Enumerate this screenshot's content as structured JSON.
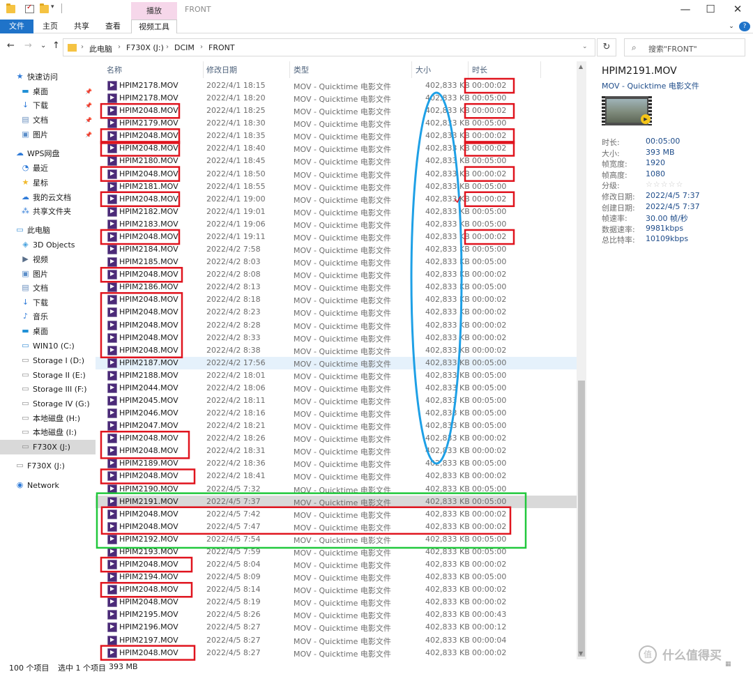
{
  "titlebar": {
    "context_tab": "播放",
    "window_title": "FRONT",
    "minimize": "—",
    "maximize": "☐",
    "close": "✕"
  },
  "ribbon": {
    "tabs": [
      "文件",
      "主页",
      "共享",
      "查看",
      "视频工具"
    ],
    "help": "?"
  },
  "address": {
    "back": "←",
    "forward": "→",
    "recent": "⌄",
    "up": "↑",
    "crumbs": [
      "此电脑",
      "F730X (J:)",
      "DCIM",
      "FRONT"
    ],
    "refresh": "↻",
    "search_placeholder": "搜索\"FRONT\""
  },
  "sidebar": {
    "items": [
      {
        "label": "快速访问",
        "icon": "star-icon",
        "color": "#2f7bd8"
      },
      {
        "label": "桌面",
        "icon": "desktop-icon",
        "color": "#1f8fd6",
        "pinned": true
      },
      {
        "label": "下载",
        "icon": "download-icon",
        "color": "#2f7bd8",
        "pinned": true
      },
      {
        "label": "文档",
        "icon": "document-icon",
        "color": "#6a8fbf",
        "pinned": true
      },
      {
        "label": "图片",
        "icon": "picture-icon",
        "color": "#5b8ec9",
        "pinned": true
      },
      {
        "label": "WPS网盘",
        "icon": "cloud-icon",
        "color": "#2f7bd8"
      },
      {
        "label": "最近",
        "icon": "clock-icon",
        "color": "#2f7bd8"
      },
      {
        "label": "星标",
        "icon": "star-icon",
        "color": "#f1b92b"
      },
      {
        "label": "我的云文档",
        "icon": "cloud-doc-icon",
        "color": "#2f7bd8"
      },
      {
        "label": "共享文件夹",
        "icon": "share-icon",
        "color": "#2f7bd8"
      },
      {
        "label": "此电脑",
        "icon": "computer-icon",
        "color": "#3c8fd6"
      },
      {
        "label": "3D Objects",
        "icon": "cube-icon",
        "color": "#4aa3df"
      },
      {
        "label": "视频",
        "icon": "video-icon",
        "color": "#5a6f8a"
      },
      {
        "label": "图片",
        "icon": "picture-icon",
        "color": "#5b8ec9"
      },
      {
        "label": "文档",
        "icon": "document-icon",
        "color": "#6a8fbf"
      },
      {
        "label": "下载",
        "icon": "download-icon",
        "color": "#2f7bd8"
      },
      {
        "label": "音乐",
        "icon": "music-icon",
        "color": "#2f7bd8"
      },
      {
        "label": "桌面",
        "icon": "desktop-icon",
        "color": "#1f8fd6"
      },
      {
        "label": "WIN10 (C:)",
        "icon": "windows-drive-icon",
        "color": "#3c8fd6"
      },
      {
        "label": "Storage I (D:)",
        "icon": "drive-icon",
        "color": "#8c8c8c"
      },
      {
        "label": "Storage II (E:)",
        "icon": "drive-icon",
        "color": "#8c8c8c"
      },
      {
        "label": "Storage III (F:)",
        "icon": "drive-icon",
        "color": "#8c8c8c"
      },
      {
        "label": "Storage IV (G:)",
        "icon": "drive-icon",
        "color": "#8c8c8c"
      },
      {
        "label": "本地磁盘 (H:)",
        "icon": "drive-icon",
        "color": "#8c8c8c"
      },
      {
        "label": "本地磁盘 (I:)",
        "icon": "drive-icon",
        "color": "#8c8c8c"
      },
      {
        "label": "F730X (J:)",
        "icon": "usb-drive-icon",
        "color": "#8c8c8c",
        "selected": true
      },
      {
        "label": "F730X (J:)",
        "icon": "usb-drive-icon",
        "color": "#8c8c8c"
      },
      {
        "label": "Network",
        "icon": "network-icon",
        "color": "#2f7bd8"
      }
    ]
  },
  "columns": [
    "名称",
    "修改日期",
    "类型",
    "大小",
    "时长"
  ],
  "files": [
    {
      "name": "HPIM2178.MOV",
      "date": "2022/4/1 18:15",
      "type": "MOV - Quicktime 电影文件",
      "size": "402,833 KB",
      "duration": "00:00:02"
    },
    {
      "name": "HPIM2178.MOV",
      "date": "2022/4/1 18:20",
      "type": "MOV - Quicktime 电影文件",
      "size": "402,833 KB",
      "duration": "00:05:00"
    },
    {
      "name": "HPIM2048.MOV",
      "date": "2022/4/1 18:25",
      "type": "MOV - Quicktime 电影文件",
      "size": "402,833 KB",
      "duration": "00:00:02"
    },
    {
      "name": "HPIM2179.MOV",
      "date": "2022/4/1 18:30",
      "type": "MOV - Quicktime 电影文件",
      "size": "402,833 KB",
      "duration": "00:05:00"
    },
    {
      "name": "HPIM2048.MOV",
      "date": "2022/4/1 18:35",
      "type": "MOV - Quicktime 电影文件",
      "size": "402,833 KB",
      "duration": "00:00:02"
    },
    {
      "name": "HPIM2048.MOV",
      "date": "2022/4/1 18:40",
      "type": "MOV - Quicktime 电影文件",
      "size": "402,833 KB",
      "duration": "00:00:02"
    },
    {
      "name": "HPIM2180.MOV",
      "date": "2022/4/1 18:45",
      "type": "MOV - Quicktime 电影文件",
      "size": "402,833 KB",
      "duration": "00:05:00"
    },
    {
      "name": "HPIM2048.MOV",
      "date": "2022/4/1 18:50",
      "type": "MOV - Quicktime 电影文件",
      "size": "402,833 KB",
      "duration": "00:00:02"
    },
    {
      "name": "HPIM2181.MOV",
      "date": "2022/4/1 18:55",
      "type": "MOV - Quicktime 电影文件",
      "size": "402,833 KB",
      "duration": "00:05:00"
    },
    {
      "name": "HPIM2048.MOV",
      "date": "2022/4/1 19:00",
      "type": "MOV - Quicktime 电影文件",
      "size": "402,833 KB",
      "duration": "00:00:02"
    },
    {
      "name": "HPIM2182.MOV",
      "date": "2022/4/1 19:01",
      "type": "MOV - Quicktime 电影文件",
      "size": "402,833 KB",
      "duration": "00:05:00"
    },
    {
      "name": "HPIM2183.MOV",
      "date": "2022/4/1 19:06",
      "type": "MOV - Quicktime 电影文件",
      "size": "402,833 KB",
      "duration": "00:05:00"
    },
    {
      "name": "HPIM2048.MOV",
      "date": "2022/4/1 19:11",
      "type": "MOV - Quicktime 电影文件",
      "size": "402,833 KB",
      "duration": "00:00:02"
    },
    {
      "name": "HPIM2184.MOV",
      "date": "2022/4/2 7:58",
      "type": "MOV - Quicktime 电影文件",
      "size": "402,833 KB",
      "duration": "00:05:00"
    },
    {
      "name": "HPIM2185.MOV",
      "date": "2022/4/2 8:03",
      "type": "MOV - Quicktime 电影文件",
      "size": "402,833 KB",
      "duration": "00:05:00"
    },
    {
      "name": "HPIM2048.MOV",
      "date": "2022/4/2 8:08",
      "type": "MOV - Quicktime 电影文件",
      "size": "402,833 KB",
      "duration": "00:00:02"
    },
    {
      "name": "HPIM2186.MOV",
      "date": "2022/4/2 8:13",
      "type": "MOV - Quicktime 电影文件",
      "size": "402,833 KB",
      "duration": "00:05:00"
    },
    {
      "name": "HPIM2048.MOV",
      "date": "2022/4/2 8:18",
      "type": "MOV - Quicktime 电影文件",
      "size": "402,833 KB",
      "duration": "00:00:02"
    },
    {
      "name": "HPIM2048.MOV",
      "date": "2022/4/2 8:23",
      "type": "MOV - Quicktime 电影文件",
      "size": "402,833 KB",
      "duration": "00:00:02"
    },
    {
      "name": "HPIM2048.MOV",
      "date": "2022/4/2 8:28",
      "type": "MOV - Quicktime 电影文件",
      "size": "402,833 KB",
      "duration": "00:00:02"
    },
    {
      "name": "HPIM2048.MOV",
      "date": "2022/4/2 8:33",
      "type": "MOV - Quicktime 电影文件",
      "size": "402,833 KB",
      "duration": "00:00:02"
    },
    {
      "name": "HPIM2048.MOV",
      "date": "2022/4/2 8:38",
      "type": "MOV - Quicktime 电影文件",
      "size": "402,833 KB",
      "duration": "00:00:02"
    },
    {
      "name": "HPIM2187.MOV",
      "date": "2022/4/2 17:56",
      "type": "MOV - Quicktime 电影文件",
      "size": "402,833 KB",
      "duration": "00:05:00"
    },
    {
      "name": "HPIM2188.MOV",
      "date": "2022/4/2 18:01",
      "type": "MOV - Quicktime 电影文件",
      "size": "402,833 KB",
      "duration": "00:05:00"
    },
    {
      "name": "HPIM2044.MOV",
      "date": "2022/4/2 18:06",
      "type": "MOV - Quicktime 电影文件",
      "size": "402,833 KB",
      "duration": "00:05:00"
    },
    {
      "name": "HPIM2045.MOV",
      "date": "2022/4/2 18:11",
      "type": "MOV - Quicktime 电影文件",
      "size": "402,833 KB",
      "duration": "00:05:00"
    },
    {
      "name": "HPIM2046.MOV",
      "date": "2022/4/2 18:16",
      "type": "MOV - Quicktime 电影文件",
      "size": "402,833 KB",
      "duration": "00:05:00"
    },
    {
      "name": "HPIM2047.MOV",
      "date": "2022/4/2 18:21",
      "type": "MOV - Quicktime 电影文件",
      "size": "402,833 KB",
      "duration": "00:05:00"
    },
    {
      "name": "HPIM2048.MOV",
      "date": "2022/4/2 18:26",
      "type": "MOV - Quicktime 电影文件",
      "size": "402,833 KB",
      "duration": "00:00:02"
    },
    {
      "name": "HPIM2048.MOV",
      "date": "2022/4/2 18:31",
      "type": "MOV - Quicktime 电影文件",
      "size": "402,833 KB",
      "duration": "00:00:02"
    },
    {
      "name": "HPIM2189.MOV",
      "date": "2022/4/2 18:36",
      "type": "MOV - Quicktime 电影文件",
      "size": "402,833 KB",
      "duration": "00:05:00"
    },
    {
      "name": "HPIM2048.MOV",
      "date": "2022/4/2 18:41",
      "type": "MOV - Quicktime 电影文件",
      "size": "402,833 KB",
      "duration": "00:00:02"
    },
    {
      "name": "HPIM2190.MOV",
      "date": "2022/4/5 7:32",
      "type": "MOV - Quicktime 电影文件",
      "size": "402,833 KB",
      "duration": "00:05:00"
    },
    {
      "name": "HPIM2191.MOV",
      "date": "2022/4/5 7:37",
      "type": "MOV - Quicktime 电影文件",
      "size": "402,833 KB",
      "duration": "00:05:00",
      "selected": true
    },
    {
      "name": "HPIM2048.MOV",
      "date": "2022/4/5 7:42",
      "type": "MOV - Quicktime 电影文件",
      "size": "402,833 KB",
      "duration": "00:00:02"
    },
    {
      "name": "HPIM2048.MOV",
      "date": "2022/4/5 7:47",
      "type": "MOV - Quicktime 电影文件",
      "size": "402,833 KB",
      "duration": "00:00:02"
    },
    {
      "name": "HPIM2192.MOV",
      "date": "2022/4/5 7:54",
      "type": "MOV - Quicktime 电影文件",
      "size": "402,833 KB",
      "duration": "00:05:00"
    },
    {
      "name": "HPIM2193.MOV",
      "date": "2022/4/5 7:59",
      "type": "MOV - Quicktime 电影文件",
      "size": "402,833 KB",
      "duration": "00:05:00"
    },
    {
      "name": "HPIM2048.MOV",
      "date": "2022/4/5 8:04",
      "type": "MOV - Quicktime 电影文件",
      "size": "402,833 KB",
      "duration": "00:00:02"
    },
    {
      "name": "HPIM2194.MOV",
      "date": "2022/4/5 8:09",
      "type": "MOV - Quicktime 电影文件",
      "size": "402,833 KB",
      "duration": "00:05:00"
    },
    {
      "name": "HPIM2048.MOV",
      "date": "2022/4/5 8:14",
      "type": "MOV - Quicktime 电影文件",
      "size": "402,833 KB",
      "duration": "00:00:02"
    },
    {
      "name": "HPIM2048.MOV",
      "date": "2022/4/5 8:19",
      "type": "MOV - Quicktime 电影文件",
      "size": "402,833 KB",
      "duration": "00:00:02"
    },
    {
      "name": "HPIM2195.MOV",
      "date": "2022/4/5 8:26",
      "type": "MOV - Quicktime 电影文件",
      "size": "402,833 KB",
      "duration": "00:00:43"
    },
    {
      "name": "HPIM2196.MOV",
      "date": "2022/4/5 8:27",
      "type": "MOV - Quicktime 电影文件",
      "size": "402,833 KB",
      "duration": "00:00:12"
    },
    {
      "name": "HPIM2197.MOV",
      "date": "2022/4/5 8:27",
      "type": "MOV - Quicktime 电影文件",
      "size": "402,833 KB",
      "duration": "00:00:04"
    },
    {
      "name": "HPIM2048.MOV",
      "date": "2022/4/5 8:27",
      "type": "MOV - Quicktime 电影文件",
      "size": "402,833 KB",
      "duration": "00:00:02"
    }
  ],
  "hover_row": 22,
  "details": {
    "filename": "HPIM2191.MOV",
    "filetype": "MOV - Quicktime 电影文件",
    "props": [
      {
        "label": "时长:",
        "value": "00:05:00"
      },
      {
        "label": "大小:",
        "value": "393 MB"
      },
      {
        "label": "帧宽度:",
        "value": "1920"
      },
      {
        "label": "帧高度:",
        "value": "1080"
      },
      {
        "label": "分级:",
        "value": "☆☆☆☆☆",
        "rating": 0
      },
      {
        "label": "修改日期:",
        "value": "2022/4/5 7:37"
      },
      {
        "label": "创建日期:",
        "value": "2022/4/5 7:37"
      },
      {
        "label": "帧速率:",
        "value": "30.00 帧/秒"
      },
      {
        "label": "数据速率:",
        "value": "9981kbps"
      },
      {
        "label": "总比特率:",
        "value": "10109kbps"
      }
    ]
  },
  "status": {
    "count": "100 个项目",
    "selected": "选中 1 个项目",
    "size": "393 MB"
  },
  "watermark": "什么值得买",
  "colors": {
    "accent": "#1f73c9",
    "context_tab": "#f6d7ea",
    "annotation_red": "#e0141e",
    "annotation_blue": "#1ea0e6",
    "annotation_green": "#21c83c"
  }
}
